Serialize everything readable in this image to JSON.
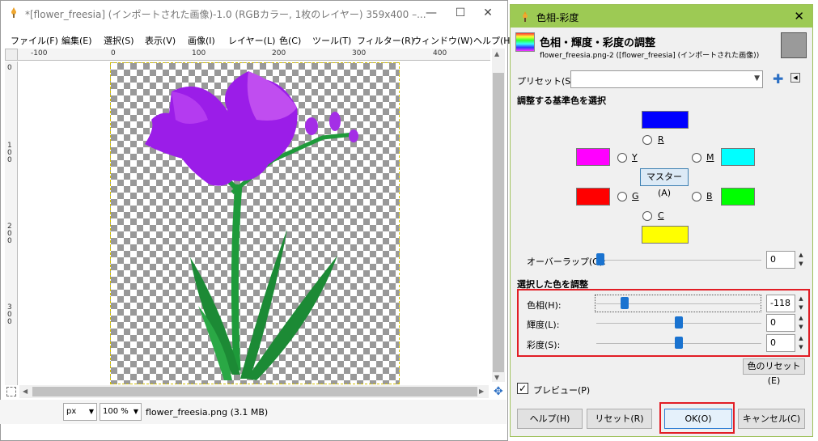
{
  "main_window": {
    "title": "*[flower_freesia] (インポートされた画像)-1.0 (RGBカラー, 1枚のレイヤー) 359x400 –...",
    "minimize": "—",
    "maximize": "☐",
    "close": "✕",
    "menu": [
      "ファイル(F)",
      "編集(E)",
      "選択(S)",
      "表示(V)",
      "画像(I)",
      "レイヤー(L)",
      "色(C)",
      "ツール(T)",
      "フィルター(R)",
      "ウィンドウ(W)",
      "ヘルプ(H)"
    ],
    "hruler_ticks": [
      "-100",
      "0",
      "100",
      "200",
      "300",
      "400"
    ],
    "vruler_ticks": [
      "0",
      "100",
      "200",
      "300"
    ],
    "status": {
      "unit": "px",
      "zoom": "100 %",
      "file_info": "flower_freesia.png (3.1 MB)"
    }
  },
  "dialog": {
    "title": "色相-彩度",
    "close": "✕",
    "header_title": "色相・輝度・彩度の調整",
    "header_subtitle": "flower_freesia.png-2 ([flower_freesia] (インポートされた画像))",
    "preset_label": "プリセット(S):",
    "preset_value": "",
    "section_primary": "調整する基準色を選択",
    "primaries": {
      "R": "R",
      "Y": "Y",
      "M": "M",
      "G": "G",
      "B": "B",
      "C": "C",
      "master": "マスター(A)"
    },
    "colors": {
      "R": "#0000ff",
      "Y": "#ff00ff",
      "M": "#00ffff",
      "G": "#ff0000",
      "B": "#00ff00",
      "C": "#ffff00"
    },
    "overlap_label": "オーバーラップ(O):",
    "overlap_value": "0",
    "overlap_level": 0,
    "section_adjust": "選択した色を調整",
    "hue_label": "色相(H):",
    "hue_value": "-118",
    "hue_range": [
      -180,
      180
    ],
    "lightness_label": "輝度(L):",
    "lightness_value": "0",
    "lightness_range": [
      -100,
      100
    ],
    "saturation_label": "彩度(S):",
    "saturation_value": "0",
    "saturation_range": [
      -100,
      100
    ],
    "reset_color": "色のリセット(E)",
    "preview_label": "プレビュー(P)",
    "preview_checked": true,
    "buttons": {
      "help": "ヘルプ(H)",
      "reset": "リセット(R)",
      "ok": "OK(O)",
      "cancel": "キャンセル(C)"
    },
    "accent_color": "#9dca54",
    "highlight_color": "#e21d25"
  }
}
